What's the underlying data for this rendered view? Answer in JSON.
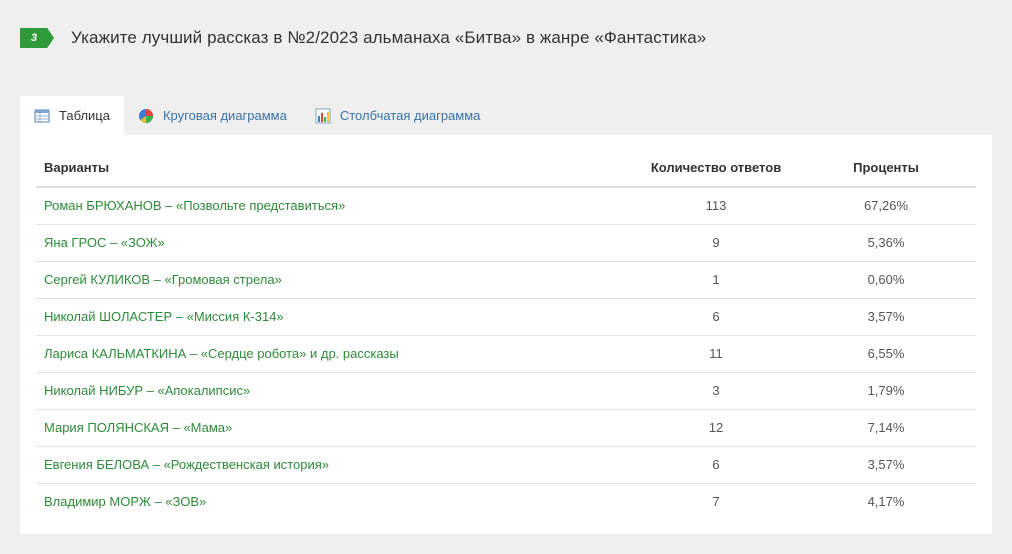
{
  "question": {
    "number": "3",
    "text": "Укажите лучший рассказ в №2/2023 альманаха «Битва» в жанре «Фантастика»"
  },
  "tabs": [
    {
      "label": "Таблица",
      "icon": "table-icon",
      "active": true
    },
    {
      "label": "Круговая диаграмма",
      "icon": "pie-chart-icon",
      "active": false
    },
    {
      "label": "Столбчатая диаграмма",
      "icon": "bar-chart-icon",
      "active": false
    }
  ],
  "table": {
    "headers": [
      "Варианты",
      "Количество ответов",
      "Проценты"
    ],
    "rows": [
      {
        "option": "Роман БРЮХАНОВ – «Позвольте представиться»",
        "count": "113",
        "percent": "67,26%"
      },
      {
        "option": "Яна ГРОС – «ЗОЖ»",
        "count": "9",
        "percent": "5,36%"
      },
      {
        "option": "Сергей КУЛИКОВ – «Громовая стрела»",
        "count": "1",
        "percent": "0,60%"
      },
      {
        "option": "Николай ШОЛАСТЕР – «Миссия К-314»",
        "count": "6",
        "percent": "3,57%"
      },
      {
        "option": "Лариса КАЛЬМАТКИНА – «Сердце робота» и др. рассказы",
        "count": "11",
        "percent": "6,55%"
      },
      {
        "option": "Николай НИБУР – «Апокалипсис»",
        "count": "3",
        "percent": "1,79%"
      },
      {
        "option": "Мария ПОЛЯНСКАЯ – «Мама»",
        "count": "12",
        "percent": "7,14%"
      },
      {
        "option": "Евгения БЕЛОВА – «Рождественская история»",
        "count": "6",
        "percent": "3,57%"
      },
      {
        "option": "Владимир МОРЖ – «ЗОВ»",
        "count": "7",
        "percent": "4,17%"
      }
    ]
  },
  "colors": {
    "accent": "#2e9a3a",
    "option_text": "#2e8b3a",
    "tab_link": "#3a73a8",
    "background": "#efefef"
  }
}
